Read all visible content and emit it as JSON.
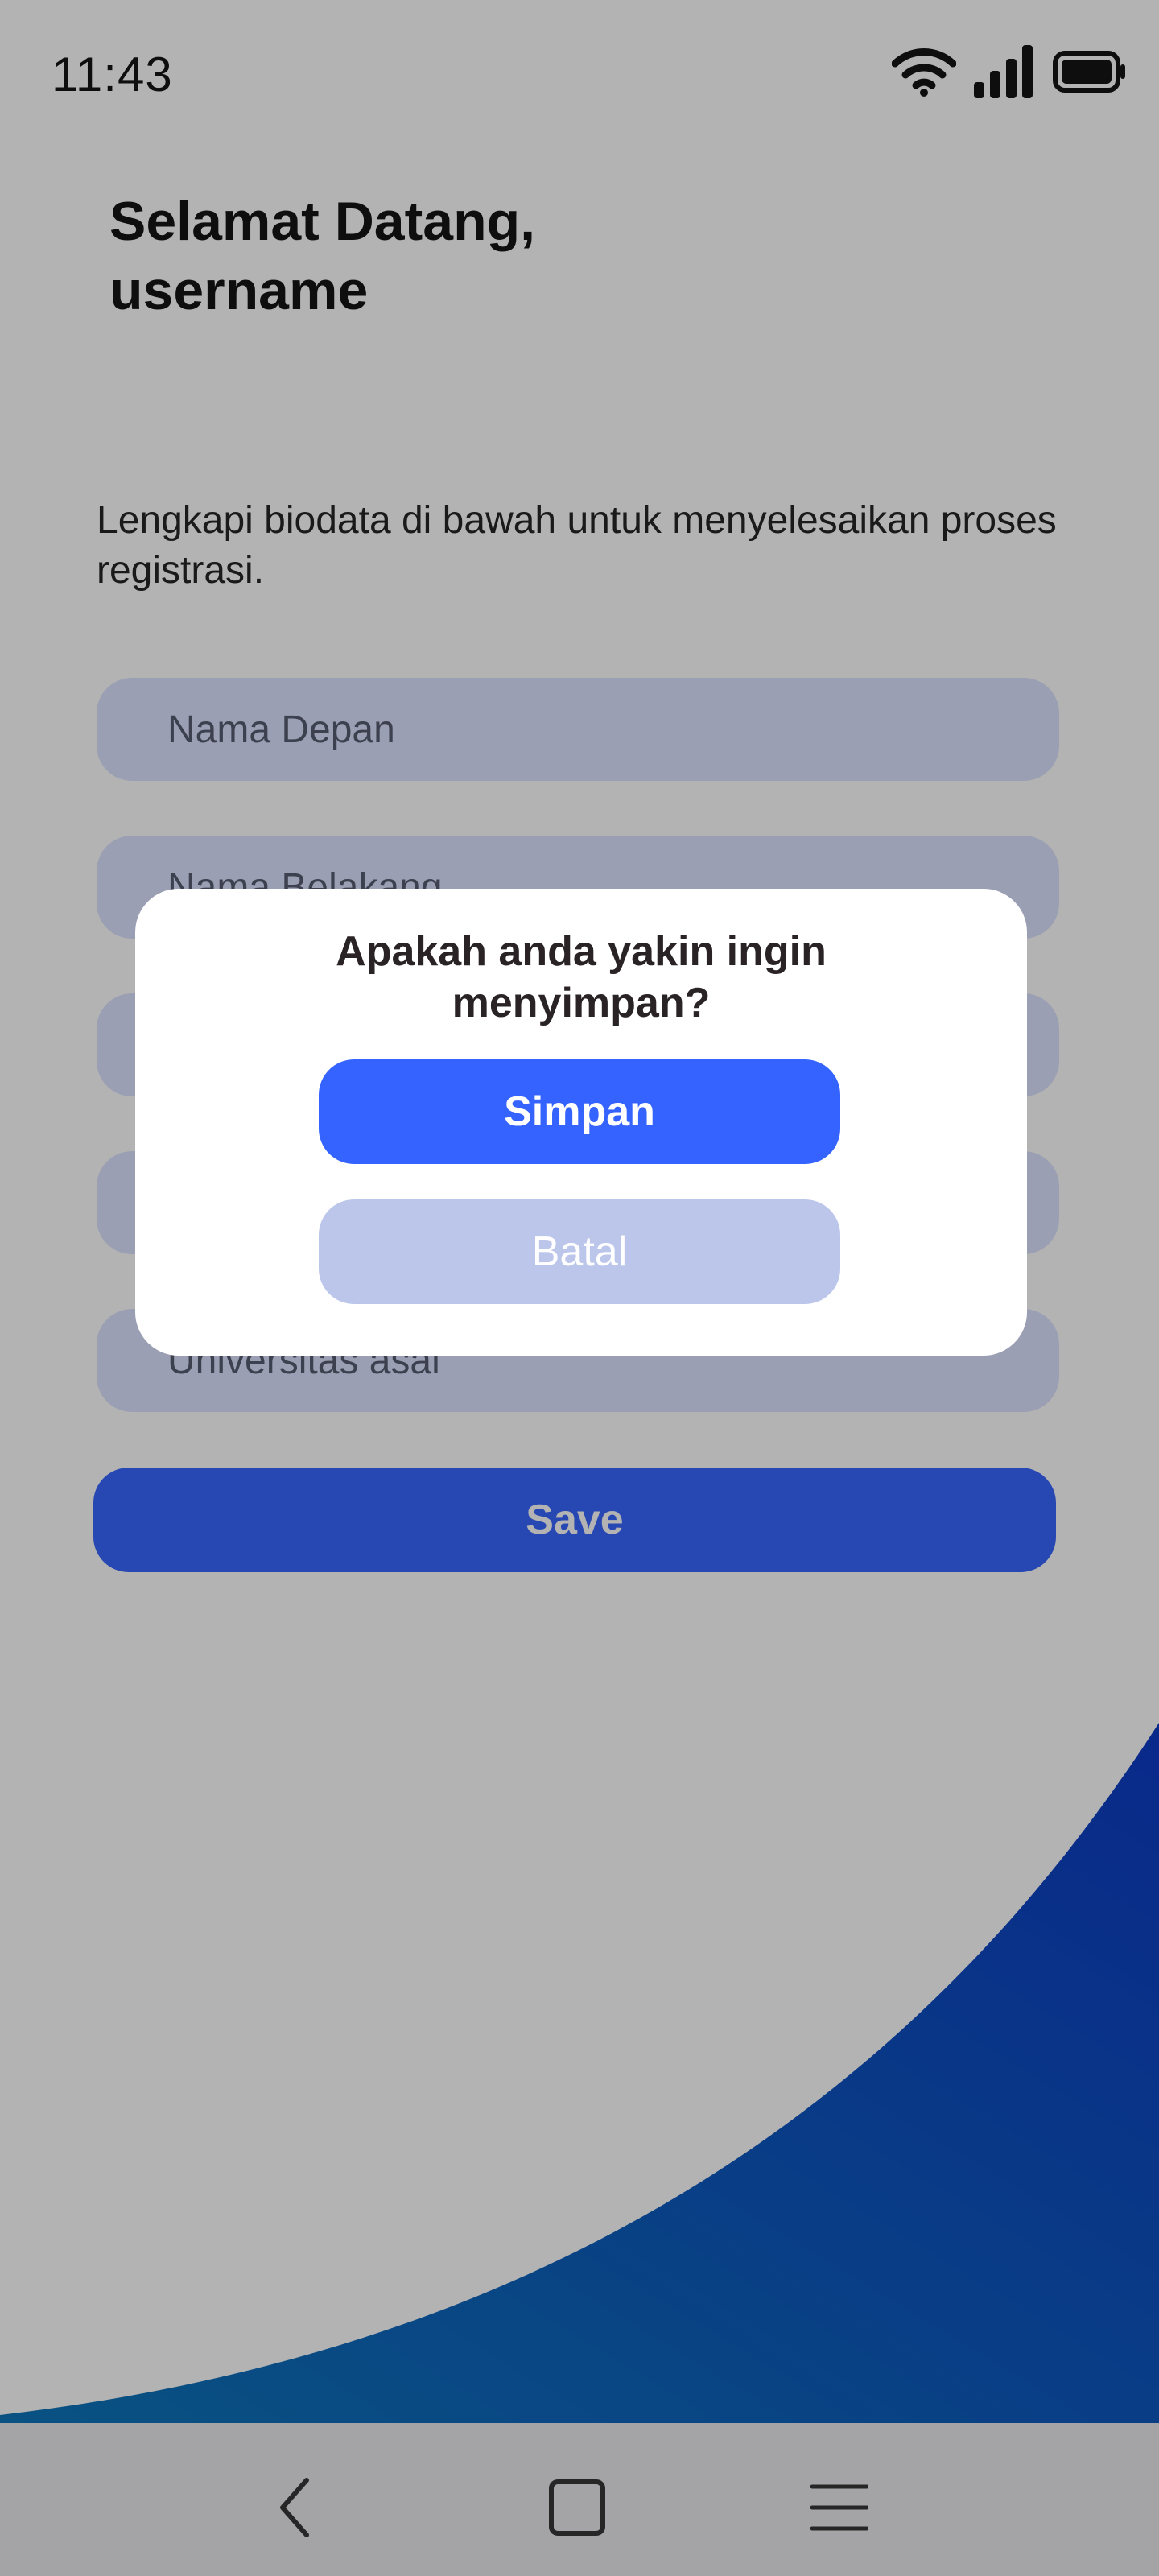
{
  "status_bar": {
    "time": "11:43",
    "icons": [
      "wifi-icon",
      "signal-icon",
      "battery-icon"
    ]
  },
  "header": {
    "greeting_line1": "Selamat Datang,",
    "greeting_line2": "username"
  },
  "form": {
    "instruction": "Lengkapi biodata di bawah untuk menyelesaikan proses registrasi.",
    "fields": [
      {
        "placeholder": "Nama Depan"
      },
      {
        "placeholder": "Nama Belakang"
      },
      {
        "placeholder": ""
      },
      {
        "placeholder": ""
      },
      {
        "placeholder": "Universitas asal"
      }
    ],
    "save_label": "Save"
  },
  "dialog": {
    "title_line1": "Apakah anda yakin ingin",
    "title_line2": "menyimpan?",
    "confirm_label": "Simpan",
    "cancel_label": "Batal"
  },
  "nav_bar": {
    "icons": [
      "back-icon",
      "home-icon",
      "menu-icon"
    ]
  },
  "colors": {
    "accent": "#3563FF",
    "cancel": "#BBC6EA",
    "field_bg": "#DDE3FF",
    "decoration_start": "#0A73B8",
    "decoration_end": "#0937C4"
  }
}
